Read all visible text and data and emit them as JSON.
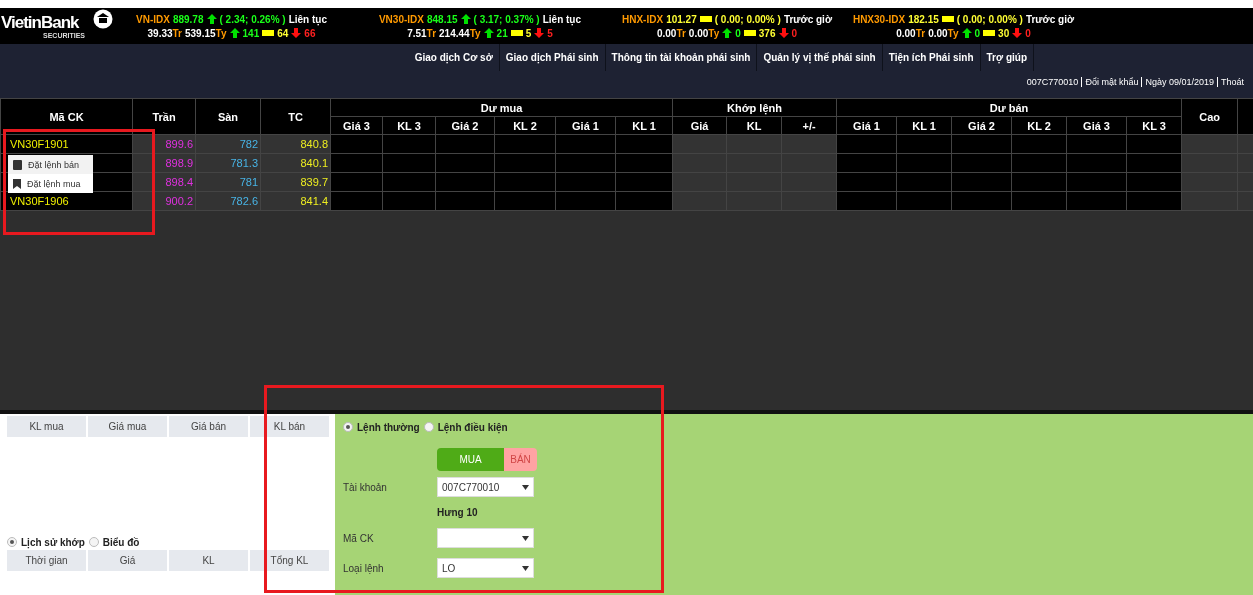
{
  "brand": {
    "name": "VietinBank",
    "tagline": "SECURITIES"
  },
  "indices": [
    {
      "name": "VN-IDX",
      "value": "889.78",
      "kind": "up",
      "change": "( 2.34; 0.26% )",
      "session": "Liên tục",
      "volume": "39.33",
      "volume_unit": "Tr",
      "turnover": "539.15",
      "turnover_unit": "Ty",
      "advances": "141",
      "unchanged": "64",
      "declines": "66"
    },
    {
      "name": "VN30-IDX",
      "value": "848.15",
      "kind": "up",
      "change": "( 3.17; 0.37% )",
      "session": "Liên tục",
      "volume": "7.51",
      "volume_unit": "Tr",
      "turnover": "214.44",
      "turnover_unit": "Ty",
      "advances": "21",
      "unchanged": "5",
      "declines": "5"
    },
    {
      "name": "HNX-IDX",
      "value": "101.27",
      "kind": "flat",
      "change": "( 0.00; 0.00% )",
      "session": "Trước giờ",
      "volume": "0.00",
      "volume_unit": "Tr",
      "turnover": "0.00",
      "turnover_unit": "Ty",
      "advances": "0",
      "unchanged": "376",
      "declines": "0"
    },
    {
      "name": "HNX30-IDX",
      "value": "182.15",
      "kind": "flat",
      "change": "( 0.00; 0.00% )",
      "session": "Trước giờ",
      "volume": "0.00",
      "volume_unit": "Tr",
      "turnover": "0.00",
      "turnover_unit": "Ty",
      "advances": "0",
      "unchanged": "30",
      "declines": "0"
    }
  ],
  "nav": [
    "Giao dịch Cơ sở",
    "Giao dịch Phái sinh",
    "Thông tin tài khoản phái sinh",
    "Quản lý vị thế phái sinh",
    "Tiện ích Phái sinh",
    "Trợ giúp"
  ],
  "account_bar": [
    "007C770010",
    "Đổi mật khẩu",
    "Ngày 09/01/2019",
    "Thoát"
  ],
  "price_board": {
    "columns": [
      {
        "label": "Mã CK"
      },
      {
        "label": "Trần"
      },
      {
        "label": "Sàn"
      },
      {
        "label": "TC"
      },
      {
        "label": "Dư mua",
        "children": [
          "Giá 3",
          "KL 3",
          "Giá 2",
          "KL 2",
          "Giá 1",
          "KL 1"
        ]
      },
      {
        "label": "Khớp lệnh",
        "children": [
          "Giá",
          "KL",
          "+/-"
        ]
      },
      {
        "label": "Dư bán",
        "children": [
          "Giá 1",
          "KL 1",
          "Giá 2",
          "KL 2",
          "Giá 3",
          "KL 3"
        ]
      },
      {
        "label": "Cao"
      }
    ],
    "rows": [
      {
        "symbol": "VN30F1901",
        "ceiling": "899.6",
        "floor": "782",
        "reference": "840.8"
      },
      {
        "ceiling": "898.9",
        "floor": "781.3",
        "reference": "840.1"
      },
      {
        "ceiling": "898.4",
        "floor": "781",
        "reference": "839.7"
      },
      {
        "symbol": "VN30F1906",
        "ceiling": "900.2",
        "floor": "782.6",
        "reference": "841.4"
      }
    ]
  },
  "context_menu": {
    "items": [
      {
        "kind": "book",
        "label": "Đặt lệnh bán"
      },
      {
        "kind": "bookmark",
        "label": "Đặt lệnh mua"
      }
    ]
  },
  "order_book": {
    "columns": [
      "KL mua",
      "Giá mua",
      "Giá bán",
      "KL bán"
    ]
  },
  "history_tabs": [
    {
      "label": "Lịch sử khớp",
      "selected": true
    },
    {
      "label": "Biểu đồ",
      "selected": false
    }
  ],
  "history_table": {
    "columns": [
      "Thời gian",
      "Giá",
      "KL",
      "Tổng KL"
    ]
  },
  "order_form": {
    "order_types": [
      {
        "label": "Lệnh thường",
        "selected": true
      },
      {
        "label": "Lệnh điều kiện",
        "selected": false
      }
    ],
    "sides": [
      {
        "label": "MUA",
        "selected": true
      },
      {
        "label": "BÁN",
        "selected": false
      }
    ],
    "fields": [
      {
        "kind": "select",
        "label": "Tài khoản",
        "value": "007C770010"
      },
      {
        "kind": "note",
        "value": "Hưng 10"
      },
      {
        "kind": "select",
        "label": "Mã CK"
      },
      {
        "kind": "select",
        "label": "Loại lệnh",
        "value": "LO"
      }
    ]
  },
  "annotations": [
    {
      "kind": "highlight",
      "color": "#e8191f"
    },
    {
      "kind": "highlight",
      "color": "#e8191f"
    }
  ]
}
